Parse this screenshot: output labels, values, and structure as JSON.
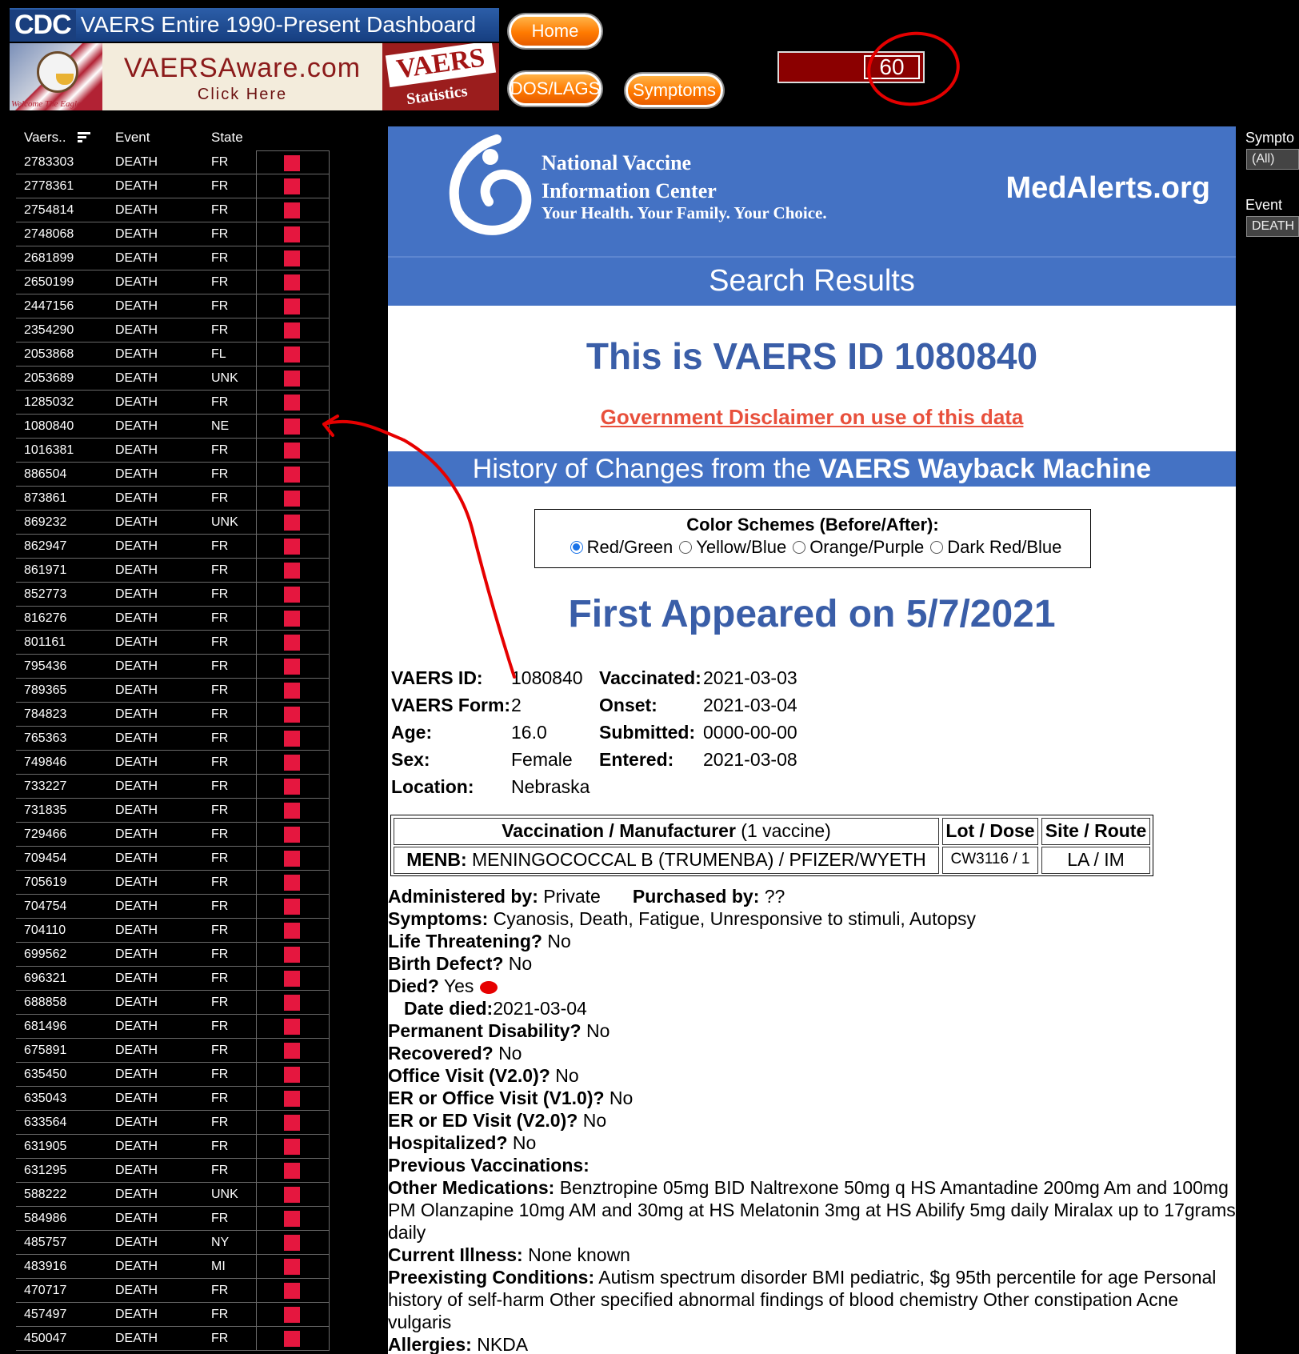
{
  "banner": {
    "cdc_logo": "CDC",
    "title": "VAERS Entire 1990-Present Dashboard",
    "eagle_caption": "Welcome The Eagle",
    "aware_name": "VAERSAware.com",
    "aware_click": "Click Here",
    "stats_big": "VAERS",
    "stats_small": "Statistics"
  },
  "nav": {
    "home": "Home",
    "dos_lags": "DOS/LAGS",
    "symptoms": "Symptoms"
  },
  "counter": {
    "value": "60"
  },
  "list": {
    "headers": {
      "vaers": "Vaers..",
      "event": "Event",
      "state": "State"
    },
    "rows": [
      {
        "id": "2783303",
        "event": "DEATH",
        "state": "FR"
      },
      {
        "id": "2778361",
        "event": "DEATH",
        "state": "FR"
      },
      {
        "id": "2754814",
        "event": "DEATH",
        "state": "FR"
      },
      {
        "id": "2748068",
        "event": "DEATH",
        "state": "FR"
      },
      {
        "id": "2681899",
        "event": "DEATH",
        "state": "FR"
      },
      {
        "id": "2650199",
        "event": "DEATH",
        "state": "FR"
      },
      {
        "id": "2447156",
        "event": "DEATH",
        "state": "FR"
      },
      {
        "id": "2354290",
        "event": "DEATH",
        "state": "FR"
      },
      {
        "id": "2053868",
        "event": "DEATH",
        "state": "FL"
      },
      {
        "id": "2053689",
        "event": "DEATH",
        "state": "UNK"
      },
      {
        "id": "1285032",
        "event": "DEATH",
        "state": "FR"
      },
      {
        "id": "1080840",
        "event": "DEATH",
        "state": "NE"
      },
      {
        "id": "1016381",
        "event": "DEATH",
        "state": "FR"
      },
      {
        "id": "886504",
        "event": "DEATH",
        "state": "FR"
      },
      {
        "id": "873861",
        "event": "DEATH",
        "state": "FR"
      },
      {
        "id": "869232",
        "event": "DEATH",
        "state": "UNK"
      },
      {
        "id": "862947",
        "event": "DEATH",
        "state": "FR"
      },
      {
        "id": "861971",
        "event": "DEATH",
        "state": "FR"
      },
      {
        "id": "852773",
        "event": "DEATH",
        "state": "FR"
      },
      {
        "id": "816276",
        "event": "DEATH",
        "state": "FR"
      },
      {
        "id": "801161",
        "event": "DEATH",
        "state": "FR"
      },
      {
        "id": "795436",
        "event": "DEATH",
        "state": "FR"
      },
      {
        "id": "789365",
        "event": "DEATH",
        "state": "FR"
      },
      {
        "id": "784823",
        "event": "DEATH",
        "state": "FR"
      },
      {
        "id": "765363",
        "event": "DEATH",
        "state": "FR"
      },
      {
        "id": "749846",
        "event": "DEATH",
        "state": "FR"
      },
      {
        "id": "733227",
        "event": "DEATH",
        "state": "FR"
      },
      {
        "id": "731835",
        "event": "DEATH",
        "state": "FR"
      },
      {
        "id": "729466",
        "event": "DEATH",
        "state": "FR"
      },
      {
        "id": "709454",
        "event": "DEATH",
        "state": "FR"
      },
      {
        "id": "705619",
        "event": "DEATH",
        "state": "FR"
      },
      {
        "id": "704754",
        "event": "DEATH",
        "state": "FR"
      },
      {
        "id": "704110",
        "event": "DEATH",
        "state": "FR"
      },
      {
        "id": "699562",
        "event": "DEATH",
        "state": "FR"
      },
      {
        "id": "696321",
        "event": "DEATH",
        "state": "FR"
      },
      {
        "id": "688858",
        "event": "DEATH",
        "state": "FR"
      },
      {
        "id": "681496",
        "event": "DEATH",
        "state": "FR"
      },
      {
        "id": "675891",
        "event": "DEATH",
        "state": "FR"
      },
      {
        "id": "635450",
        "event": "DEATH",
        "state": "FR"
      },
      {
        "id": "635043",
        "event": "DEATH",
        "state": "FR"
      },
      {
        "id": "633564",
        "event": "DEATH",
        "state": "FR"
      },
      {
        "id": "631905",
        "event": "DEATH",
        "state": "FR"
      },
      {
        "id": "631295",
        "event": "DEATH",
        "state": "FR"
      },
      {
        "id": "588222",
        "event": "DEATH",
        "state": "UNK"
      },
      {
        "id": "584986",
        "event": "DEATH",
        "state": "FR"
      },
      {
        "id": "485757",
        "event": "DEATH",
        "state": "NY"
      },
      {
        "id": "483916",
        "event": "DEATH",
        "state": "MI"
      },
      {
        "id": "470717",
        "event": "DEATH",
        "state": "FR"
      },
      {
        "id": "457497",
        "event": "DEATH",
        "state": "FR"
      },
      {
        "id": "450047",
        "event": "DEATH",
        "state": "FR"
      }
    ]
  },
  "filters": {
    "symptom_label": "Sympto",
    "symptom_value": "(All)",
    "event_label": "Event",
    "event_value": "DEATH"
  },
  "nvic": {
    "line1": "National Vaccine",
    "line2": "Information Center",
    "tagline": "Your Health. Your Family. Your Choice.",
    "site": "MedAlerts.org"
  },
  "search_results": "Search Results",
  "vaers_title": "This is VAERS ID 1080840",
  "disclaimer": "Government Disclaimer on use of this data",
  "history": {
    "prefix": "History of Changes from the ",
    "bold": "VAERS Wayback Machine"
  },
  "schemes": {
    "title": "Color Schemes (Before/After):",
    "options": [
      "Red/Green",
      "Yellow/Blue",
      "Orange/Purple",
      "Dark Red/Blue"
    ],
    "selected": "Red/Green"
  },
  "first_appeared": "First Appeared on 5/7/2021",
  "facts": {
    "vaers_id_label": "VAERS ID:",
    "vaers_id": "1080840",
    "form_label": "VAERS Form:",
    "form": "2",
    "age_label": "Age:",
    "age": "16.0",
    "sex_label": "Sex:",
    "sex": "Female",
    "location_label": "Location:",
    "location": "Nebraska",
    "vaccinated_label": "Vaccinated:",
    "vaccinated": "2021-03-03",
    "onset_label": "Onset:",
    "onset": "2021-03-04",
    "submitted_label": "Submitted:",
    "submitted": "0000-00-00",
    "entered_label": "Entered:",
    "entered": "2021-03-08"
  },
  "vax_table": {
    "h_vax": "Vaccination / Manufacturer",
    "h_vax_count": "(1 vaccine)",
    "h_lot": "Lot / Dose",
    "h_site": "Site / Route",
    "vax_code": "MENB:",
    "vax_name": "MENINGOCOCCAL B (TRUMENBA) / PFIZER/WYETH",
    "lot": "CW3116 / 1",
    "site": "LA / IM"
  },
  "details": {
    "administered_label": "Administered by:",
    "administered": "Private",
    "purchased_label": "Purchased by:",
    "purchased": "??",
    "symptoms_label": "Symptoms:",
    "symptoms": "Cyanosis, Death, Fatigue, Unresponsive to stimuli, Autopsy",
    "life_label": "Life Threatening?",
    "life": "No",
    "birth_label": "Birth Defect?",
    "birth": "No",
    "died_label": "Died?",
    "died": "Yes",
    "date_died_label": "Date died:",
    "date_died": "2021-03-04",
    "disability_label": "Permanent Disability?",
    "disability": "No",
    "recovered_label": "Recovered?",
    "recovered": "No",
    "office_label": "Office Visit (V2.0)?",
    "office": "No",
    "er_office_label": "ER or Office Visit (V1.0)?",
    "er_office": "No",
    "er_ed_label": "ER or ED Visit (V2.0)?",
    "er_ed": "No",
    "hosp_label": "Hospitalized?",
    "hosp": "No",
    "prev_label": "Previous Vaccinations:",
    "othermeds_label": "Other Medications:",
    "othermeds": "Benztropine 05mg BID Naltrexone 50mg q HS Amantadine 200mg Am and 100mg PM Olanzapine 10mg AM and 30mg at HS Melatonin 3mg at HS Abilify 5mg daily Miralax up to 17grams daily",
    "illness_label": "Current Illness:",
    "illness": "None known",
    "preexisting_label": "Preexisting Conditions:",
    "preexisting": "Autism spectrum disorder BMI pediatric, $g 95th percentile for age Personal history of self-harm Other specified abnormal findings of blood chemistry Other constipation Acne vulgaris",
    "allergies_label": "Allergies:",
    "allergies": "NKDA"
  }
}
